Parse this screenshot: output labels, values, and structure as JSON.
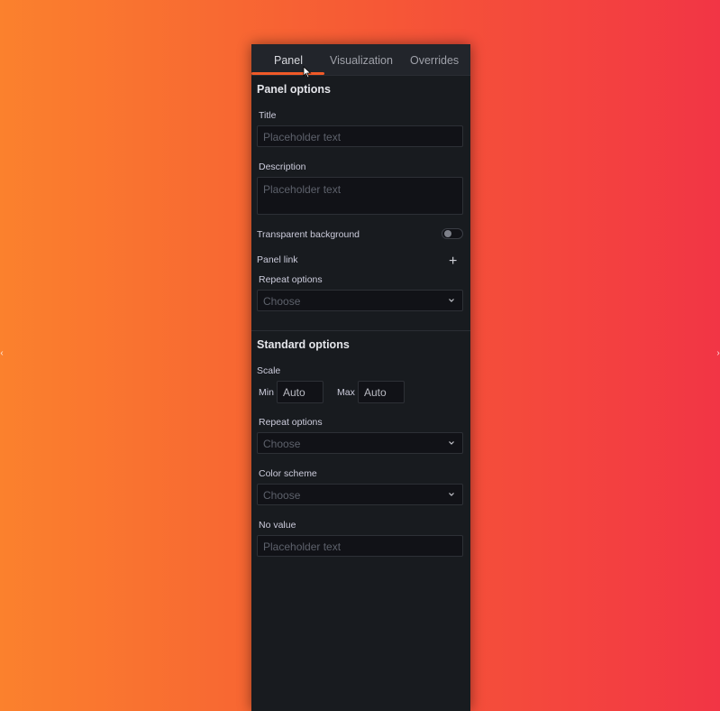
{
  "tabs": [
    {
      "label": "Panel",
      "active": true
    },
    {
      "label": "Visualization",
      "active": false
    },
    {
      "label": "Overrides",
      "active": false
    }
  ],
  "accent_color": "#f05a28",
  "panel_options": {
    "title": "Panel options",
    "title_field": {
      "label": "Title",
      "placeholder": "Placeholder text"
    },
    "description_field": {
      "label": "Description",
      "placeholder": "Placeholder text"
    },
    "transparent_background": {
      "label": "Transparent background",
      "enabled": false
    },
    "panel_link": {
      "label": "Panel link",
      "add_icon": "plus-icon"
    },
    "repeat_options": {
      "label": "Repeat options",
      "value": "Choose"
    }
  },
  "standard_options": {
    "title": "Standard options",
    "scale": {
      "label": "Scale",
      "min_label": "Min",
      "min_value": "Auto",
      "max_label": "Max",
      "max_value": "Auto"
    },
    "repeat_options": {
      "label": "Repeat options",
      "value": "Choose"
    },
    "color_scheme": {
      "label": "Color scheme",
      "value": "Choose"
    },
    "no_value": {
      "label": "No value",
      "placeholder": "Placeholder text"
    }
  },
  "icons": {
    "dropdown": "chevron-down-icon",
    "cursor": "mouse-pointer-icon"
  }
}
